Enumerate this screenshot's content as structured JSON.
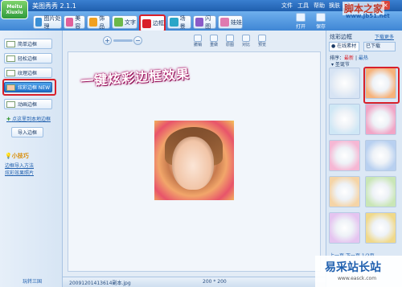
{
  "app": {
    "logo_text": "Meitu Xiuxiu",
    "title": "美图秀秀 2.1.1",
    "menu": [
      "文件",
      "工具",
      "帮助",
      "换肤",
      "设置"
    ]
  },
  "tabs": [
    {
      "label": "图片处理",
      "color": "#3a8fd6"
    },
    {
      "label": "美容",
      "color": "#e0609a"
    },
    {
      "label": "饰品",
      "color": "#f0a020"
    },
    {
      "label": "文字",
      "color": "#6cb84a"
    },
    {
      "label": "边框",
      "color": "#d9202a"
    },
    {
      "label": "场景",
      "color": "#2aa6c8"
    },
    {
      "label": "闪图",
      "color": "#8a5ac8"
    },
    {
      "label": "娃娃",
      "color": "#e07ab0"
    }
  ],
  "toolbar_right": {
    "open": "打开",
    "save": "保存"
  },
  "left_panel": {
    "buttons": [
      "简单边框",
      "轻松边框",
      "纹理边框",
      "炫彩边框 NEW",
      "动画边框"
    ],
    "link_more": "点这里到本地边框",
    "import_btn": "导入边框",
    "tips_title": "小技巧",
    "tips": [
      "边框导入方法",
      "炫彩效果照片"
    ],
    "footer": "玩转三国"
  },
  "canvas": {
    "tools": [
      "撤销",
      "重做",
      "原图",
      "对比",
      "预览"
    ],
    "headline": "一键炫彩边框效果"
  },
  "status": {
    "filename": "20091201413614副本.jpg",
    "size": "200 * 200"
  },
  "right_panel": {
    "title": "炫彩边框",
    "download": "下载更多",
    "tab_online": "在线素材",
    "tab_downloaded": "已下载",
    "sort_label": "排序：",
    "sort_new": "最新",
    "sort_hot": "最热",
    "category": "圣诞节",
    "pager": [
      "上一页",
      "下一页",
      "1",
      "/",
      "2",
      "页"
    ],
    "thumb_colors": [
      "#d7e4f4",
      "#f6b27a",
      "#cfe7f5",
      "#f1a5c6",
      "#f6b7d4",
      "#b8d0f0",
      "#f5d4a6",
      "#c9e6b6",
      "#e5c4f0",
      "#f0d98a",
      "#c0e2f0",
      "#f3c6d7"
    ]
  },
  "watermark": {
    "top": "脚本之家",
    "top_url": "www.Jb51.net",
    "bottom": "易采站长站",
    "bottom_url": "www.easck.com"
  }
}
